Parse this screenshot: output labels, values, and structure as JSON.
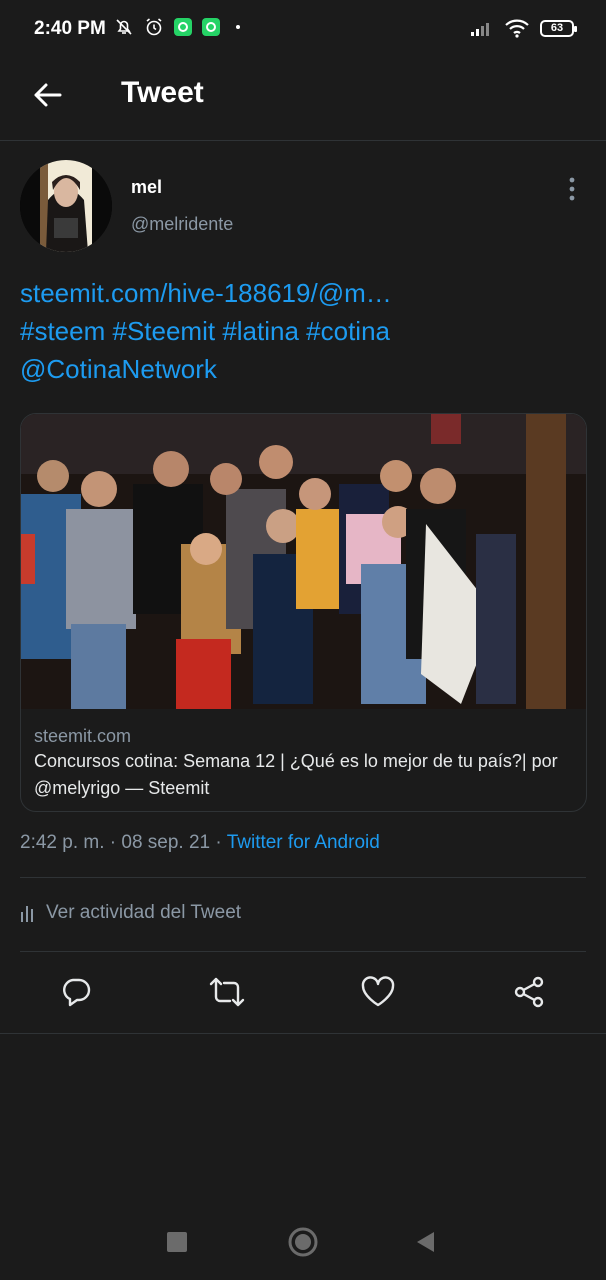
{
  "status_bar": {
    "time": "2:40 PM",
    "battery": "63",
    "icons": [
      "bell-off-icon",
      "alarm-icon",
      "whatsapp-icon",
      "whatsapp-icon",
      "signal-icon",
      "wifi-icon",
      "battery-icon"
    ]
  },
  "header": {
    "title": "Tweet"
  },
  "tweet": {
    "author_name": "mel",
    "author_handle": "@melridente",
    "text_lines": [
      "steemit.com/hive-188619/@m…",
      "#steem #Steemit #latina #cotina",
      "@CotinaNetwork"
    ],
    "card": {
      "domain": "steemit.com",
      "title": "Concursos cotina: Semana 12 | ¿Qué es lo mejor de tu país?| por @melyrigo — Steemit"
    },
    "time": "2:42 p. m.",
    "date": "08 sep. 21",
    "source": "Twitter for Android",
    "activity_label": "Ver actividad del Tweet"
  },
  "colors": {
    "background": "#1b1b1b",
    "link": "#1d9bf0",
    "muted": "#8b98a5",
    "divider": "#2f3336"
  }
}
